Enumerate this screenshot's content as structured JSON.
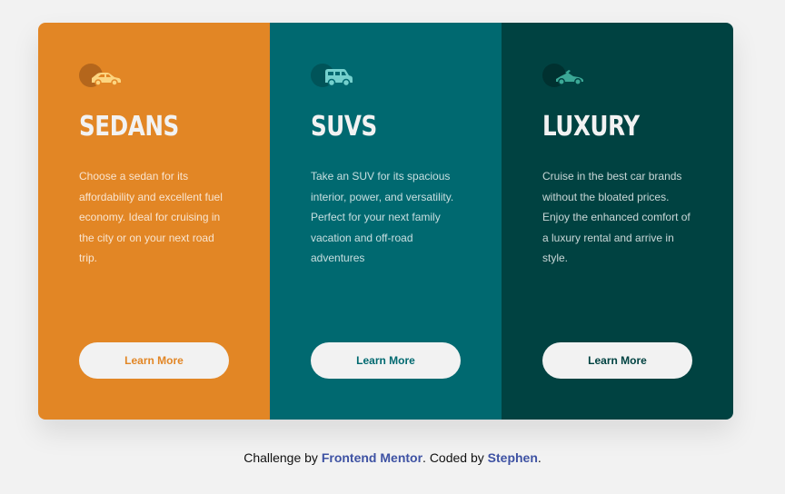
{
  "colors": {
    "background": "#f2f2f2",
    "sedans": "#e28625",
    "suvs": "#006970",
    "luxury": "#004241",
    "text_light": "#f2f2f2",
    "link": "#3e52a3"
  },
  "cards": [
    {
      "icon": "sedan-car-icon",
      "title": "SEDANS",
      "text": "Choose a sedan for its affordability and excellent fuel economy. Ideal for cruising in the city or on your next road trip.",
      "button": "Learn More"
    },
    {
      "icon": "suv-car-icon",
      "title": "SUVS",
      "text": "Take an SUV for its spacious interior, power, and versatility. Perfect for your next family vacation and off-road adventures",
      "button": "Learn More"
    },
    {
      "icon": "luxury-car-icon",
      "title": "LUXURY",
      "text": "Cruise in the best car brands without the bloated prices. Enjoy the enhanced comfort of a luxury rental and arrive in style.",
      "button": "Learn More"
    }
  ],
  "attribution": {
    "prefix": "Challenge by",
    "frontend_mentor": "Frontend Mentor",
    "middle": ". Coded by",
    "author": "Stephen",
    "suffix": "."
  }
}
